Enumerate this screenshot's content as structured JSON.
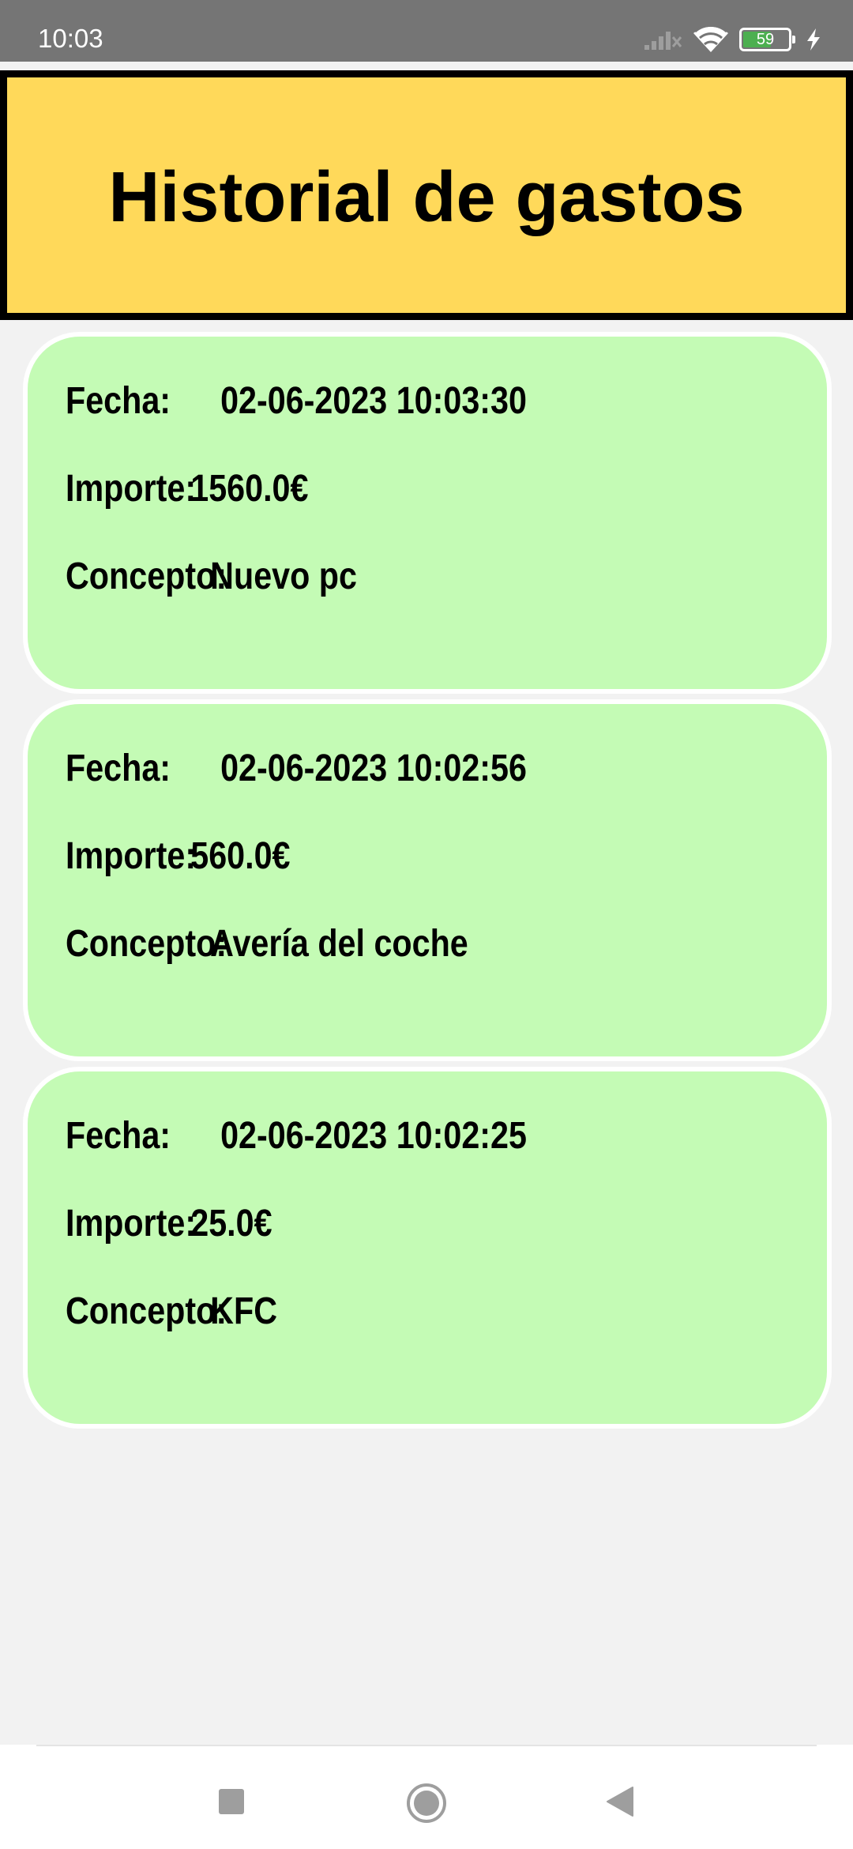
{
  "status_bar": {
    "time": "10:03",
    "battery_level": "59",
    "icons": [
      "signal-icon",
      "wifi-icon",
      "battery-icon",
      "charging-icon"
    ]
  },
  "header": {
    "title": "Historial de gastos",
    "background_color": "#ffd95a"
  },
  "card_color": "#c4fbb5",
  "expenses": [
    {
      "fecha_label": "Fecha:",
      "fecha": "02-06-2023 10:03:30",
      "importe_label": "Importe:",
      "importe": "1560.0€",
      "concepto_label": "Concepto:",
      "concepto": "Nuevo pc"
    },
    {
      "fecha_label": "Fecha:",
      "fecha": "02-06-2023 10:02:56",
      "importe_label": "Importe:",
      "importe": "560.0€",
      "concepto_label": "Concepto:",
      "concepto": "Avería del coche"
    },
    {
      "fecha_label": "Fecha:",
      "fecha": "02-06-2023 10:02:25",
      "importe_label": "Importe:",
      "importe": "25.0€",
      "concepto_label": "Concepto:",
      "concepto": "KFC"
    }
  ],
  "nav_bar": {
    "buttons": [
      "recents-square-icon",
      "home-circle-icon",
      "back-triangle-icon"
    ]
  }
}
